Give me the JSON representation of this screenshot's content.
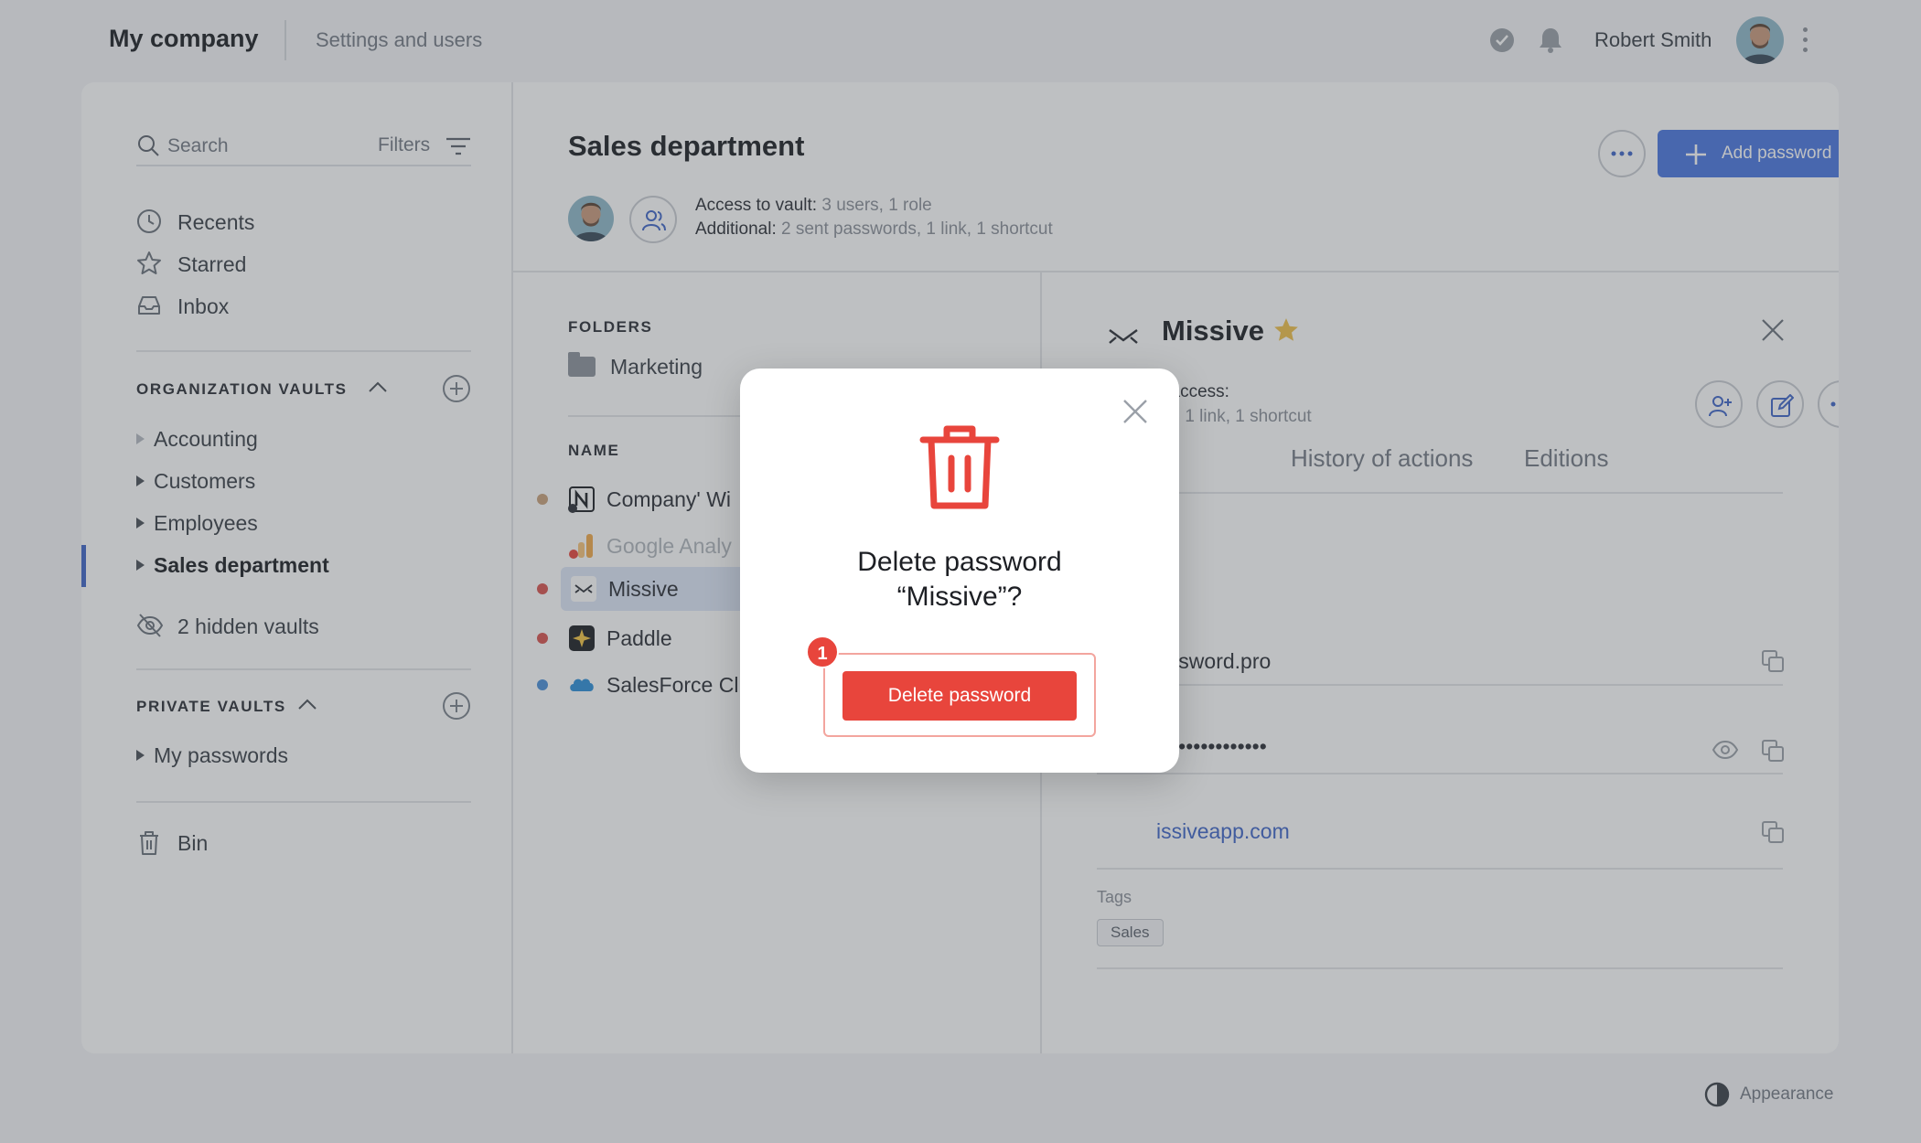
{
  "topbar": {
    "app_title": "My company",
    "crumb": "Settings and users",
    "user_name": "Robert Smith"
  },
  "sidebar": {
    "search_placeholder": "Search",
    "filters_label": "Filters",
    "nav": [
      {
        "label": "Recents",
        "icon": "clock-icon"
      },
      {
        "label": "Starred",
        "icon": "star-icon"
      },
      {
        "label": "Inbox",
        "icon": "inbox-icon"
      }
    ],
    "org_vaults_title": "ORGANIZATION VAULTS",
    "org_vaults": [
      {
        "label": "Accounting"
      },
      {
        "label": "Customers"
      },
      {
        "label": "Employees"
      },
      {
        "label": "Sales department",
        "active": true
      }
    ],
    "hidden_vaults": "2 hidden vaults",
    "private_vaults_title": "PRIVATE VAULTS",
    "private_vaults": [
      {
        "label": "My passwords"
      }
    ],
    "bin_label": "Bin"
  },
  "vault_header": {
    "title": "Sales department",
    "access_label": "Access to vault:",
    "access_value": "3 users, 1 role",
    "additional_label": "Additional:",
    "additional_value": "2 sent passwords, 1 link, 1 shortcut",
    "add_password_label": "Add password",
    "accent_color": "#4a77e0"
  },
  "list": {
    "folders_title": "FOLDERS",
    "folders": [
      {
        "label": "Marketing"
      }
    ],
    "name_title": "NAME",
    "items": [
      {
        "name": "Company' Wi",
        "dot": "#c9a27c",
        "icon": "notion-icon"
      },
      {
        "name": "Google Analy",
        "dot": "",
        "icon": "google-analytics-icon",
        "faint": true
      },
      {
        "name": "Missive",
        "dot": "#d9534f",
        "icon": "missive-icon",
        "selected": true
      },
      {
        "name": "Paddle",
        "dot": "#d9534f",
        "icon": "paddle-icon"
      },
      {
        "name": "SalesForce Cl",
        "dot": "#4a8fd9",
        "icon": "salesforce-icon"
      }
    ]
  },
  "detail": {
    "title": "Missive",
    "access_label": "l access:",
    "access_sub": "ts, 1 link, 1 shortcut",
    "tabs": [
      "History of actions",
      "Editions"
    ],
    "login_value": "assword.pro",
    "password_mask": "•••••••••••••••",
    "url_value": "issiveapp.com",
    "tags_label": "Tags",
    "tags": [
      "Sales"
    ]
  },
  "footer": {
    "appearance_label": "Appearance"
  },
  "modal": {
    "title_line1": "Delete password",
    "title_line2": "“Missive”?",
    "delete_label": "Delete password",
    "step_badge": "1",
    "danger_color": "#e8453c"
  }
}
